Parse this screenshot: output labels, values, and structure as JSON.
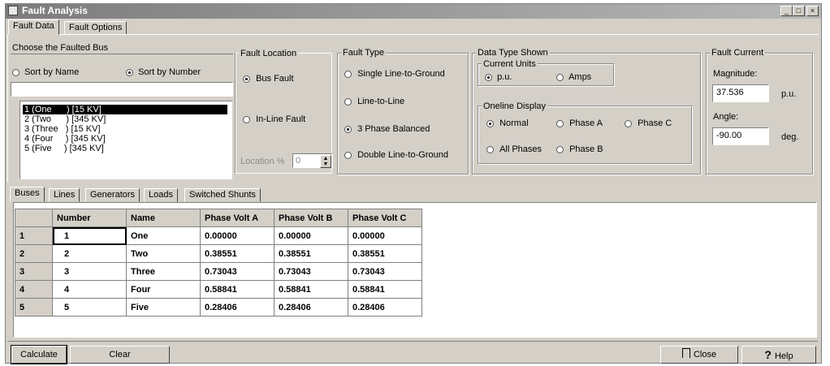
{
  "window": {
    "title": "Fault Analysis"
  },
  "top_tabs": [
    "Fault Data",
    "Fault Options"
  ],
  "choose_bus": {
    "title": "Choose the Faulted Bus",
    "sort_name": "Sort by Name",
    "sort_number": "Sort by Number",
    "search_value": "",
    "buses": [
      "1 (One      ) [15 KV]",
      "2 (Two      ) [345 KV]",
      "3 (Three   ) [15 KV]",
      "4 (Four     ) [345 KV]",
      "5 (Five     ) [345 KV]"
    ]
  },
  "fault_location": {
    "title": "Fault Location",
    "bus_fault": "Bus Fault",
    "inline_fault": "In-Line Fault",
    "location_label": "Location %",
    "location_value": "0"
  },
  "fault_type": {
    "title": "Fault Type",
    "options": [
      "Single Line-to-Ground",
      "Line-to-Line",
      "3 Phase Balanced",
      "Double Line-to-Ground"
    ]
  },
  "data_type": {
    "title": "Data Type Shown",
    "current_units": "Current Units",
    "pu": "p.u.",
    "amps": "Amps",
    "oneline": "Oneline Display",
    "normal": "Normal",
    "phase_a": "Phase A",
    "phase_c": "Phase C",
    "all_phases": "All Phases",
    "phase_b": "Phase B"
  },
  "fault_current": {
    "title": "Fault Current",
    "magnitude_label": "Magnitude:",
    "magnitude_value": "37.536",
    "magnitude_unit": "p.u.",
    "angle_label": "Angle:",
    "angle_value": "-90.00",
    "angle_unit": "deg."
  },
  "lower_tabs": [
    "Buses",
    "Lines",
    "Generators",
    "Loads",
    "Switched Shunts"
  ],
  "table": {
    "headers": [
      "",
      "Number",
      "Name",
      "Phase Volt A",
      "Phase Volt B",
      "Phase Volt C"
    ],
    "rows": [
      [
        "1",
        "1",
        "One",
        "0.00000",
        "0.00000",
        "0.00000"
      ],
      [
        "2",
        "2",
        "Two",
        "0.38551",
        "0.38551",
        "0.38551"
      ],
      [
        "3",
        "3",
        "Three",
        "0.73043",
        "0.73043",
        "0.73043"
      ],
      [
        "4",
        "4",
        "Four",
        "0.58841",
        "0.58841",
        "0.58841"
      ],
      [
        "5",
        "5",
        "Five",
        "0.28406",
        "0.28406",
        "0.28406"
      ]
    ]
  },
  "buttons": {
    "calculate": "Calculate",
    "clear": "Clear",
    "close": "Close",
    "help": "Help"
  }
}
